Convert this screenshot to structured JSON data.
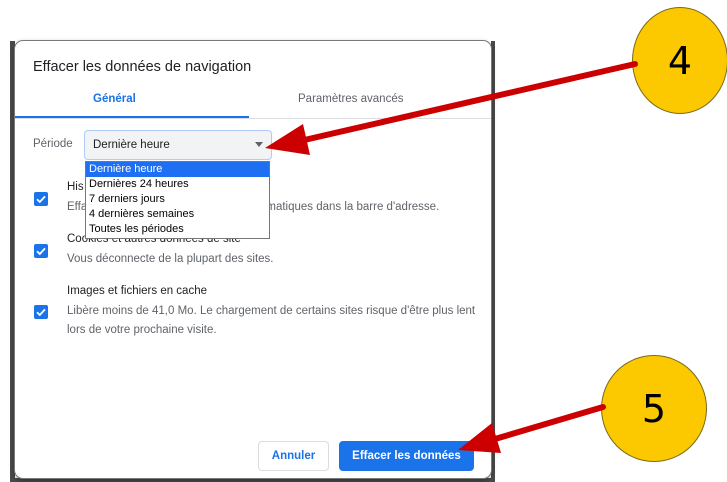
{
  "dialog": {
    "title": "Effacer les données de navigation",
    "tabs": [
      {
        "label": "Général",
        "active": true
      },
      {
        "label": "Paramètres avancés",
        "active": false
      }
    ],
    "period": {
      "label": "Période",
      "selected": "Dernière heure",
      "options": [
        {
          "label": "Dernière heure",
          "selected": true
        },
        {
          "label": "Dernières 24 heures",
          "selected": false
        },
        {
          "label": "7 derniers jours",
          "selected": false
        },
        {
          "label": "4 dernières semaines",
          "selected": false
        },
        {
          "label": "Toutes les périodes",
          "selected": false
        }
      ]
    },
    "items": [
      {
        "title": "His",
        "description": "Effa",
        "description_tail": "automatiques dans la barre d'adresse.",
        "checked": true
      },
      {
        "title": "Cookies et autres données de site",
        "description": "Vous déconnecte de la plupart des sites.",
        "checked": true
      },
      {
        "title": "Images et fichiers en cache",
        "description": "Libère moins de 41,0 Mo. Le chargement de certains sites risque d'être plus lent lors de votre prochaine visite.",
        "checked": true
      }
    ],
    "buttons": {
      "cancel": "Annuler",
      "confirm": "Effacer les données"
    }
  },
  "annotations": {
    "step_a": "4",
    "step_b": "5",
    "circle_color": "#fcc800",
    "arrow_color": "#cc0000"
  },
  "colors": {
    "accent": "#1a73e8",
    "option_highlight": "#1e6ff2"
  }
}
